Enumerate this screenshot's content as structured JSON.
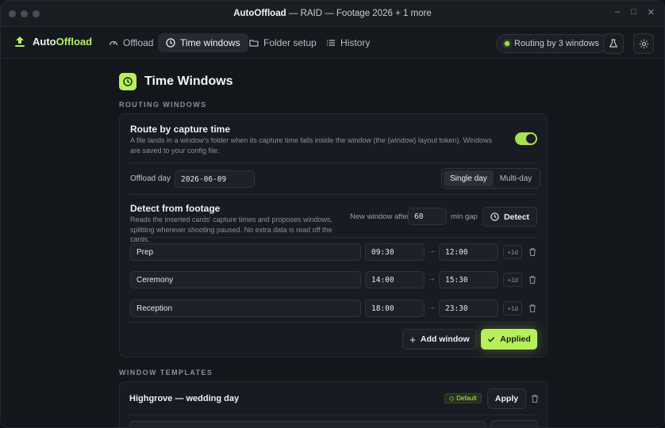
{
  "window": {
    "title_app": "AutoOffload",
    "title_rest": " — RAID — Footage 2026 + 1 more",
    "controls": [
      "–",
      "□",
      "✕"
    ]
  },
  "brand": {
    "part1": "Auto",
    "part2": "Offload"
  },
  "nav": {
    "tabs": [
      {
        "label": "Offload",
        "icon": "gauge-icon"
      },
      {
        "label": "Time windows",
        "icon": "clock-icon",
        "active": true
      },
      {
        "label": "Folder setup",
        "icon": "folder-icon"
      },
      {
        "label": "History",
        "icon": "list-icon"
      }
    ],
    "routing_status": "Routing by 3 windows"
  },
  "page": {
    "title": "Time Windows",
    "section_routing": "ROUTING WINDOWS",
    "section_templates": "WINDOW TEMPLATES"
  },
  "route": {
    "title": "Route by capture time",
    "description": "A file lands in a window's folder when its capture time falls inside the window (the {window} layout token). Windows are saved to your config file.",
    "enabled": true
  },
  "offload_day": {
    "label": "Offload day",
    "value": "2026-06-09",
    "mode_single": "Single day",
    "mode_multi": "Multi-day",
    "selected_mode": "Single day"
  },
  "detect": {
    "title": "Detect from footage",
    "description": "Reads the inserted cards' capture times and proposes windows, splitting wherever shooting paused. No extra data is read off the cards.",
    "gap_label": "New window after",
    "gap_value": "60",
    "gap_unit": "min gap",
    "button": "Detect"
  },
  "windows": [
    {
      "name": "Prep",
      "start": "09:30",
      "end": "12:00",
      "plus_day": "+1d"
    },
    {
      "name": "Ceremony",
      "start": "14:00",
      "end": "15:30",
      "plus_day": "+1d"
    },
    {
      "name": "Reception",
      "start": "18:00",
      "end": "23:30",
      "plus_day": "+1d"
    }
  ],
  "actions": {
    "add_window": "Add window",
    "applied": "Applied"
  },
  "templates": {
    "items": [
      {
        "name": "Highgrove — wedding day",
        "badge": "Default",
        "apply": "Apply"
      }
    ]
  },
  "colors": {
    "accent": "#b6f05a",
    "background": "#13161b",
    "card": "#181b21"
  }
}
